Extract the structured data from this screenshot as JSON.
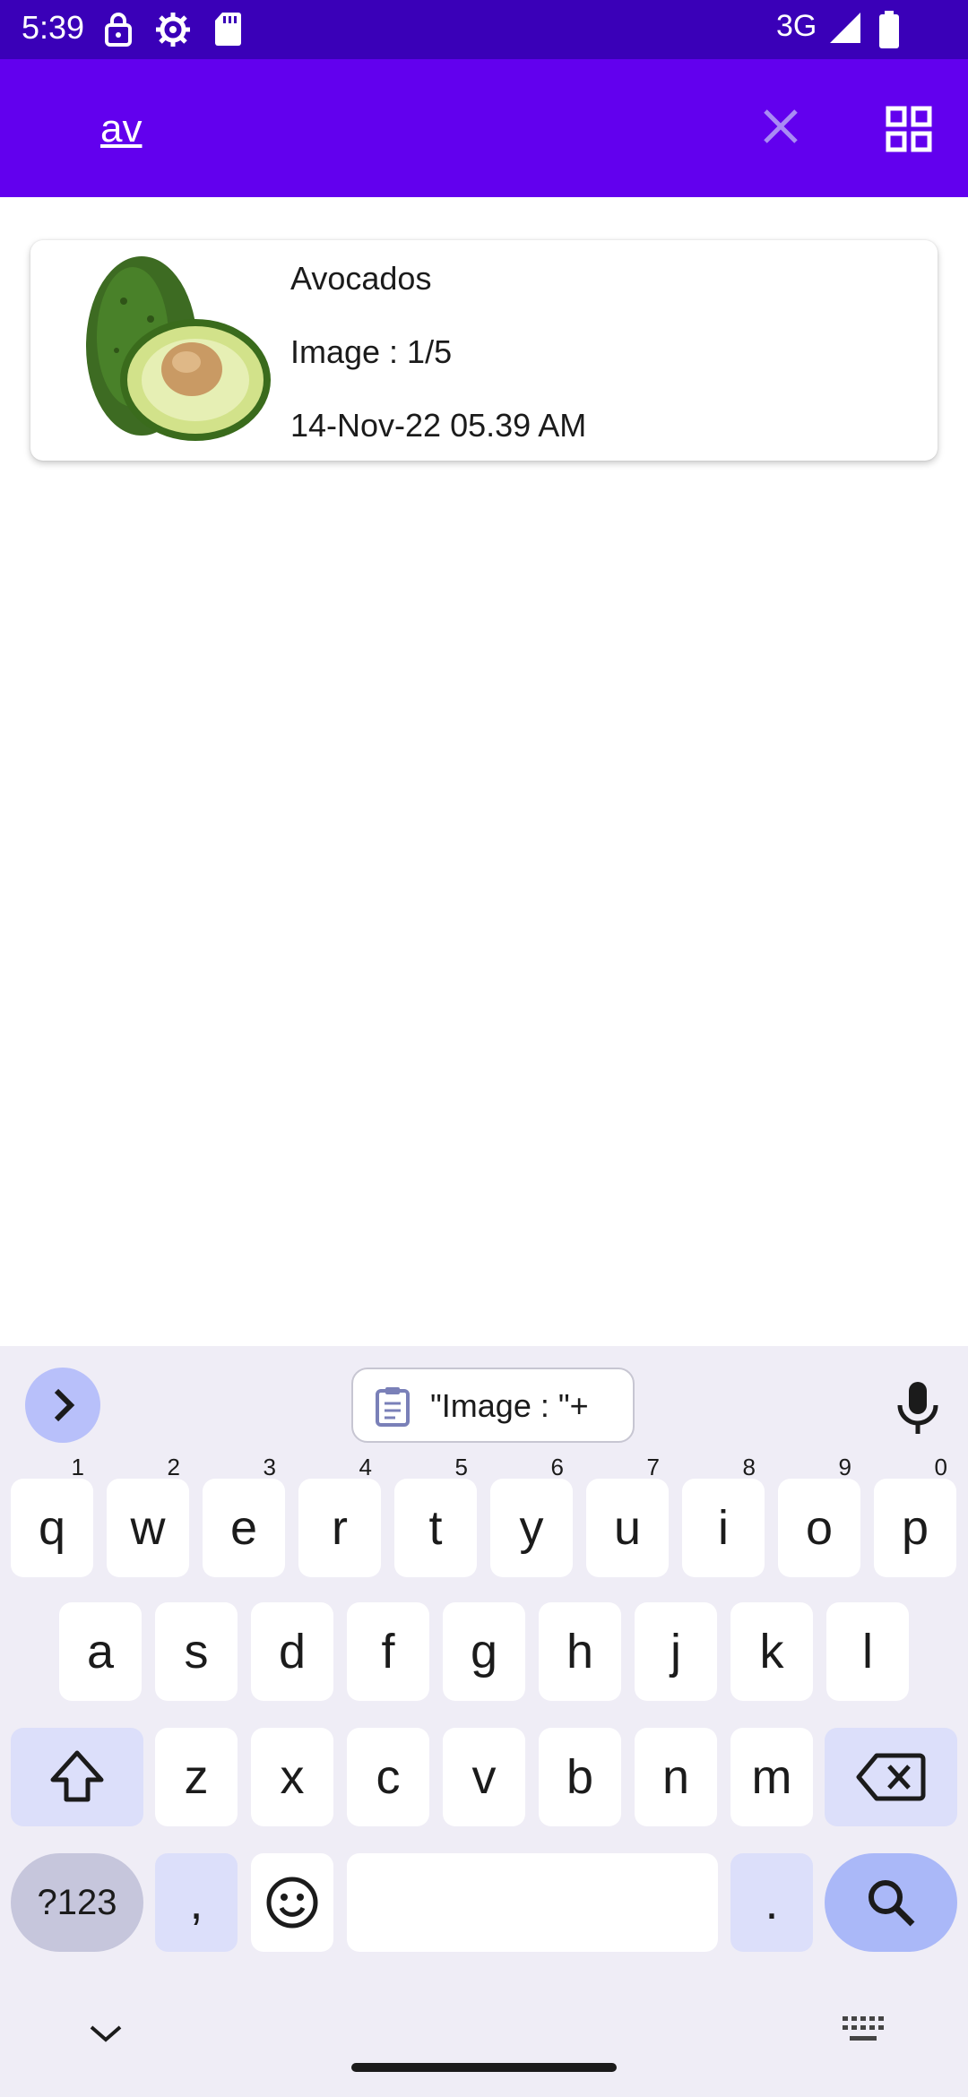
{
  "status_bar": {
    "time": "5:39",
    "network": "3G"
  },
  "search": {
    "value": "av"
  },
  "results": [
    {
      "name": "Avocados",
      "image_count": "Image : 1/5",
      "date": "14-Nov-22 05.39 AM"
    }
  ],
  "keyboard": {
    "clipboard_suggestion": "\"Image : \"+",
    "row1": [
      {
        "k": "q",
        "n": "1"
      },
      {
        "k": "w",
        "n": "2"
      },
      {
        "k": "e",
        "n": "3"
      },
      {
        "k": "r",
        "n": "4"
      },
      {
        "k": "t",
        "n": "5"
      },
      {
        "k": "y",
        "n": "6"
      },
      {
        "k": "u",
        "n": "7"
      },
      {
        "k": "i",
        "n": "8"
      },
      {
        "k": "o",
        "n": "9"
      },
      {
        "k": "p",
        "n": "0"
      }
    ],
    "row2": [
      "a",
      "s",
      "d",
      "f",
      "g",
      "h",
      "j",
      "k",
      "l"
    ],
    "row3": [
      "z",
      "x",
      "c",
      "v",
      "b",
      "n",
      "m"
    ],
    "symbols_label": "?123",
    "comma": ",",
    "period": "."
  },
  "colors": {
    "app_bar": "#6200ee",
    "status_bar": "#3a00b8",
    "keyboard_bg": "#efedf6"
  }
}
